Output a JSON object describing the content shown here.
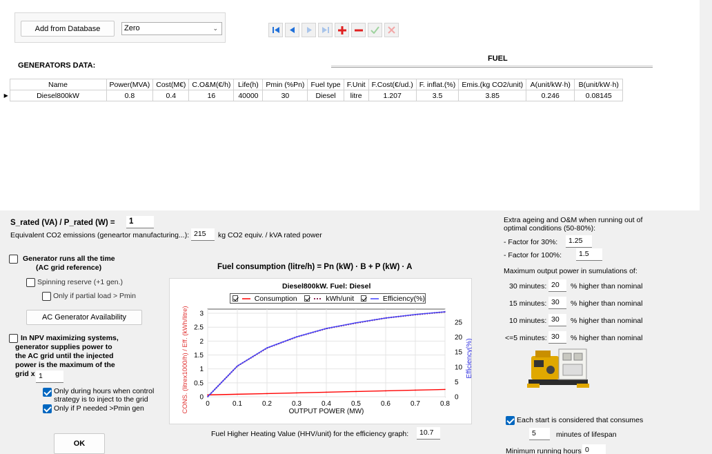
{
  "toolbar": {
    "add_from_db": "Add from Database",
    "db_selected": "Zero"
  },
  "grid": {
    "title": "GENERATORS DATA:",
    "fuel_header": "FUEL",
    "columns": [
      "Name",
      "Power(MVA)",
      "Cost(M€)",
      "C.O&M(€/h)",
      "Life(h)",
      "Pmin (%Pn)",
      "Fuel type",
      "F.Unit",
      "F.Cost(€/ud.)",
      "F. inflat.(%)",
      "Emis.(kg CO2/unit)",
      "A(unit/kW·h)",
      "B(unit/kW·h)"
    ],
    "rows": [
      [
        "Diesel800kW",
        "0.8",
        "0.4",
        "16",
        "40000",
        "30",
        "Diesel",
        "litre",
        "1.207",
        "3.5",
        "3.85",
        "0.246",
        "0.08145"
      ]
    ]
  },
  "ratio": {
    "label": "S_rated (VA) / P_rated (W) =",
    "value": "1"
  },
  "co2": {
    "label": "Equivalent CO2 emissions (geneartor manufacturing...):",
    "value": "215",
    "unit": "kg CO2 equiv. / kVA rated power"
  },
  "options": {
    "runs_all_time_l1": "Generator runs all the time",
    "runs_all_time_l2": "(AC grid reference)",
    "spinning": "Spinning reserve (+1 gen.)",
    "partial_load": "Only if partial load > Pmin",
    "availability_btn": "AC Generator Availability",
    "npv_l1": "In NPV maximizing systems,",
    "npv_l2": "generator supplies power to",
    "npv_l3": "the AC grid until the injected",
    "npv_l4": "power is the maximum of the",
    "npv_l5": "grid x",
    "npv_value": "1",
    "only_hours_l1": "Only during hours when control",
    "only_hours_l2": "strategy is to inject to the grid",
    "only_pmin": "Only if P needed >Pmin gen",
    "ok": "OK"
  },
  "chart_data": {
    "type": "line",
    "title": "Fuel consumption (litre/h) = Pn (kW) · B + P (kW) · A",
    "subtitle": "Diesel800kW. Fuel: Diesel",
    "xlabel": "OUTPUT POWER (MW)",
    "ylabel": "CONS. (litrex1000/h) / Eff. (kWh/litre)",
    "y2label": "Efficiency(%)",
    "xlim": [
      0,
      0.8
    ],
    "ylim": [
      0,
      3.15
    ],
    "y2lim": [
      0,
      29.4
    ],
    "xticks": [
      "0",
      "0.1",
      "0.2",
      "0.3",
      "0.4",
      "0.5",
      "0.6",
      "0.7",
      "0.8"
    ],
    "yticks": [
      "0",
      "0.5",
      "1",
      "1.5",
      "2",
      "2.5",
      "3"
    ],
    "y2ticks": [
      "0",
      "5",
      "10",
      "15",
      "20",
      "25"
    ],
    "x": [
      0,
      0.1,
      0.2,
      0.3,
      0.4,
      0.5,
      0.6,
      0.7,
      0.8
    ],
    "series": [
      {
        "name": "Consumption",
        "color": "#ff0000",
        "axis": "left",
        "values": [
          0.065,
          0.09,
          0.114,
          0.139,
          0.163,
          0.188,
          0.212,
          0.237,
          0.262
        ]
      },
      {
        "name": "kWh/unit",
        "color": "#8b2252",
        "axis": "left",
        "values": [
          0,
          1.1,
          1.75,
          2.15,
          2.45,
          2.65,
          2.83,
          2.95,
          3.05
        ]
      },
      {
        "name": "Efficiency(%)",
        "color": "#4040ff",
        "axis": "right",
        "values": [
          0,
          10.3,
          16.4,
          20.1,
          22.9,
          24.8,
          26.4,
          27.6,
          28.5
        ]
      }
    ]
  },
  "hhv": {
    "label": "Fuel Higher Heating Value (HHV/unit) for the efficiency graph:",
    "value": "10.7"
  },
  "ageing": {
    "l1": "Extra ageing and O&M when running out of",
    "l2": "optimal conditions (50-80%):",
    "f30_label": "- Factor for 30%:",
    "f30": "1.25",
    "f100_label": "- Factor for 100%:",
    "f100": "1.5"
  },
  "maxpower": {
    "label": "Maximum output power in sumulations of:",
    "suffix": "% higher than nominal",
    "rows": [
      {
        "label": "30 minutes:",
        "value": "20"
      },
      {
        "label": "15 minutes:",
        "value": "30"
      },
      {
        "label": "10 minutes:",
        "value": "30"
      },
      {
        "label": "<=5 minutes:",
        "value": "30"
      }
    ]
  },
  "start": {
    "label": "Each start is considered that consumes",
    "value": "5",
    "suffix": "minutes of lifespan"
  },
  "minrun": {
    "label": "Minimum running hours",
    "value": "0"
  }
}
